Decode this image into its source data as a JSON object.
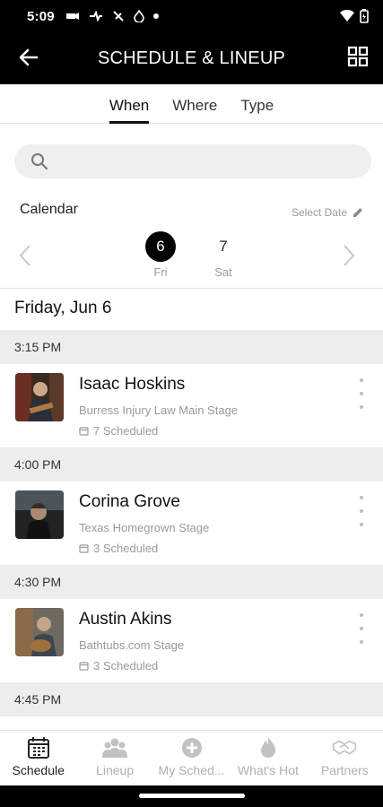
{
  "status": {
    "time": "5:09"
  },
  "appbar": {
    "title": "SCHEDULE & LINEUP"
  },
  "tabs": [
    {
      "label": "When",
      "active": true
    },
    {
      "label": "Where",
      "active": false
    },
    {
      "label": "Type",
      "active": false
    }
  ],
  "search": {
    "placeholder": ""
  },
  "calendar": {
    "label": "Calendar",
    "select_date": "Select Date",
    "days": [
      {
        "num": "6",
        "name": "Fri",
        "selected": true
      },
      {
        "num": "7",
        "name": "Sat",
        "selected": false
      }
    ]
  },
  "date_header": "Friday, Jun 6",
  "events": [
    {
      "time": "3:15 PM",
      "name": "Isaac Hoskins",
      "stage": "Burress Injury Law Main Stage",
      "scheduled": "7 Scheduled"
    },
    {
      "time": "4:00 PM",
      "name": "Corina Grove",
      "stage": "Texas Homegrown Stage",
      "scheduled": "3 Scheduled"
    },
    {
      "time": "4:30 PM",
      "name": "Austin Akins",
      "stage": "Bathtubs.com Stage",
      "scheduled": "3 Scheduled"
    },
    {
      "time": "4:45 PM"
    }
  ],
  "nav": [
    {
      "label": "Schedule",
      "icon": "calendar-icon",
      "active": true
    },
    {
      "label": "Lineup",
      "icon": "group-icon",
      "active": false
    },
    {
      "label": "My Sched...",
      "icon": "add-circle-icon",
      "active": false
    },
    {
      "label": "What's Hot",
      "icon": "flame-icon",
      "active": false
    },
    {
      "label": "Partners",
      "icon": "handshake-icon",
      "active": false
    }
  ],
  "colors": {
    "bar": "#000000",
    "accent": "#111111",
    "muted": "#9a9a9a",
    "time_band": "#ededed"
  }
}
